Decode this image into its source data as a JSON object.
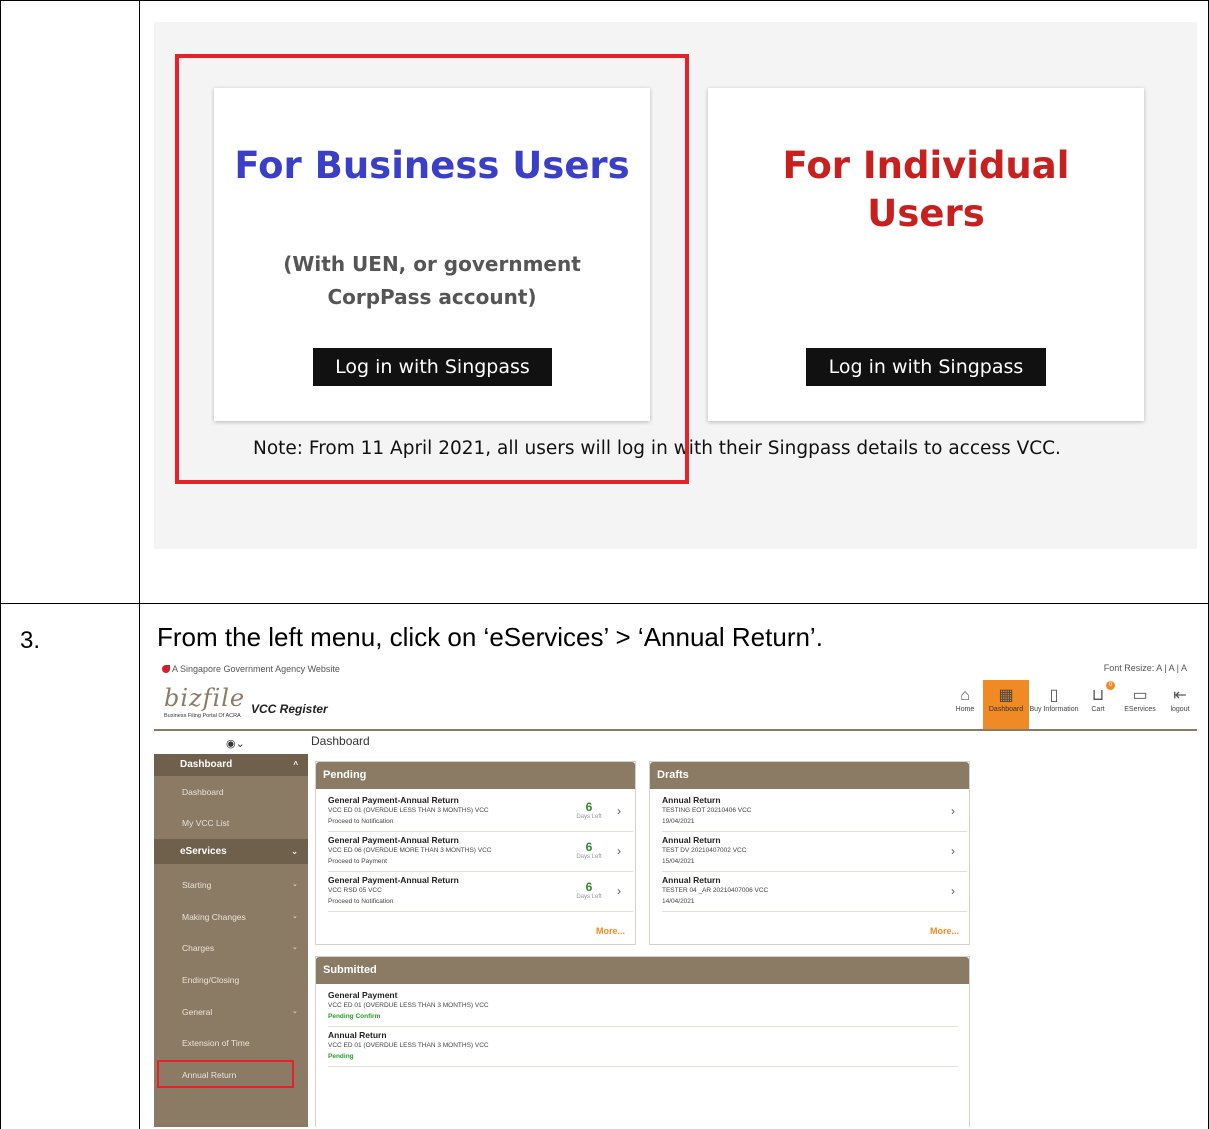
{
  "row_number": "3.",
  "instruction": "From the left menu, click on ‘eServices’ > ‘Annual Return’.",
  "login": {
    "business_title": "For Business Users",
    "business_subtitle_1": "(With UEN, or government",
    "business_subtitle_2": "CorpPass account)",
    "business_button": "Log in with Singpass",
    "individual_title_1": "For Individual",
    "individual_title_2": "Users",
    "individual_button": "Log in with Singpass",
    "note": "Note: From 11 April 2021, all users will log in with their Singpass details to access VCC.",
    "colors": {
      "business": "#3b3fc7",
      "individual": "#c8201f",
      "highlight": "#e8202a"
    }
  },
  "vcc": {
    "gov_bar": "A Singapore Government Agency Website",
    "font_resize": "Font Resize: A | A | A",
    "logo": "bizfile",
    "logo_sub": "Business Filing Portal Of ACRA",
    "app_title": "VCC Register",
    "nav": [
      {
        "label": "Home",
        "icon": "home-icon",
        "glyph": "⌂"
      },
      {
        "label": "Dashboard",
        "icon": "dashboard-icon",
        "glyph": "▦"
      },
      {
        "label": "Buy Information",
        "icon": "document-icon",
        "glyph": "▯"
      },
      {
        "label": "Cart",
        "icon": "cart-icon",
        "glyph": "⊔",
        "badge": "0"
      },
      {
        "label": "EServices",
        "icon": "file-icon",
        "glyph": "▭"
      },
      {
        "label": "logout",
        "icon": "logout-icon",
        "glyph": "⇤"
      }
    ],
    "breadcrumb": "Dashboard",
    "sidebar": {
      "dashboard_head": "Dashboard",
      "dashboard_items": [
        "Dashboard",
        "My VCC List"
      ],
      "eservices_head": "eServices",
      "eservices_items": [
        "Starting",
        "Making Changes",
        "Charges",
        "Ending/Closing",
        "General",
        "Extension of Time",
        "Annual Return"
      ]
    },
    "pending": {
      "title": "Pending",
      "items": [
        {
          "title": "General Payment-Annual Return",
          "line": "VCC ED 01 (OVERDUE LESS THAN 3 MONTHS) VCC",
          "status": "Proceed to Notification",
          "days": "6",
          "days_label": "Days Left"
        },
        {
          "title": "General Payment-Annual Return",
          "line": "VCC ED 06 (OVERDUE MORE THAN 3 MONTHS) VCC",
          "status": "Proceed to Payment",
          "days": "6",
          "days_label": "Days Left"
        },
        {
          "title": "General Payment-Annual Return",
          "line": "VCC RSD 05 VCC",
          "status": "Proceed to Notification",
          "days": "6",
          "days_label": "Days Left"
        }
      ],
      "more": "More..."
    },
    "drafts": {
      "title": "Drafts",
      "items": [
        {
          "title": "Annual Return",
          "line": "TESTING EOT 20210406 VCC",
          "status": "19/04/2021"
        },
        {
          "title": "Annual Return",
          "line": "TEST DV 20210407002 VCC",
          "status": "15/04/2021"
        },
        {
          "title": "Annual Return",
          "line": "TESTER 04 _AR 20210407006 VCC",
          "status": "14/04/2021"
        }
      ],
      "more": "More..."
    },
    "submitted": {
      "title": "Submitted",
      "items": [
        {
          "title": "General Payment",
          "line": "VCC ED 01 (OVERDUE LESS THAN 3 MONTHS) VCC",
          "status": "Pending Confirm"
        },
        {
          "title": "Annual Return",
          "line": "VCC ED 01 (OVERDUE LESS THAN 3 MONTHS) VCC",
          "status": "Pending"
        }
      ]
    }
  }
}
